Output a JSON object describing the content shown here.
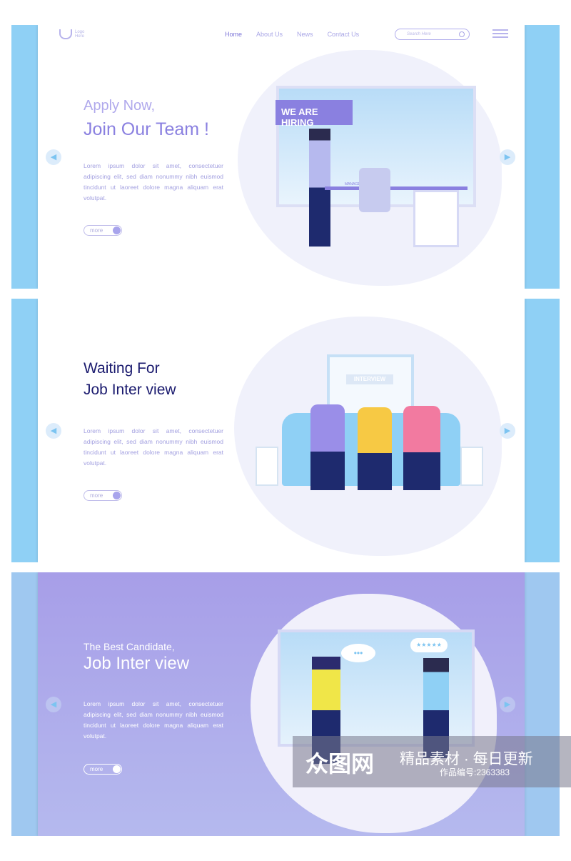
{
  "nav": {
    "logo": [
      "Logo",
      "Here"
    ],
    "links": [
      "Home",
      "About Us",
      "News",
      "Contact Us"
    ],
    "search_placeholder": "Search Here"
  },
  "slides": [
    {
      "title_small": "Apply Now,",
      "title_big": "Join Our  Team !",
      "body": "Lorem ipsum dolor sit amet, consectetuer adipiscing elit, sed diam nonummy nibh euismod tincidunt ut laoreet dolore magna aliquam erat volutpat.",
      "more": "more",
      "sign": "WE ARE HIRING",
      "desk_label": "MANAGER"
    },
    {
      "title_small": "Waiting For",
      "title_big": "Job Inter  view",
      "body": "Lorem ipsum dolor sit amet, consectetuer adipiscing elit, sed diam nonummy nibh euismod tincidunt ut laoreet dolore magna aliquam erat volutpat.",
      "more": "more",
      "sign": "INTERVIEW"
    },
    {
      "title_small": "The Best Candidate,",
      "title_big": "Job Inter  view",
      "body": "Lorem ipsum dolor sit amet, consectetuer adipiscing elit, sed diam nonummy nibh euismod tincidunt ut laoreet dolore magna aliquam erat volutpat.",
      "more": "more",
      "rating": "★★★★★"
    }
  ],
  "watermark": {
    "brand": "众图网",
    "slogan": "精品素材 · 每日更新",
    "id": "作品编号:2363383"
  },
  "colors": {
    "accent": "#8a80e0",
    "side": "#8fd0f5",
    "dark_title": "#1a1a6e"
  }
}
